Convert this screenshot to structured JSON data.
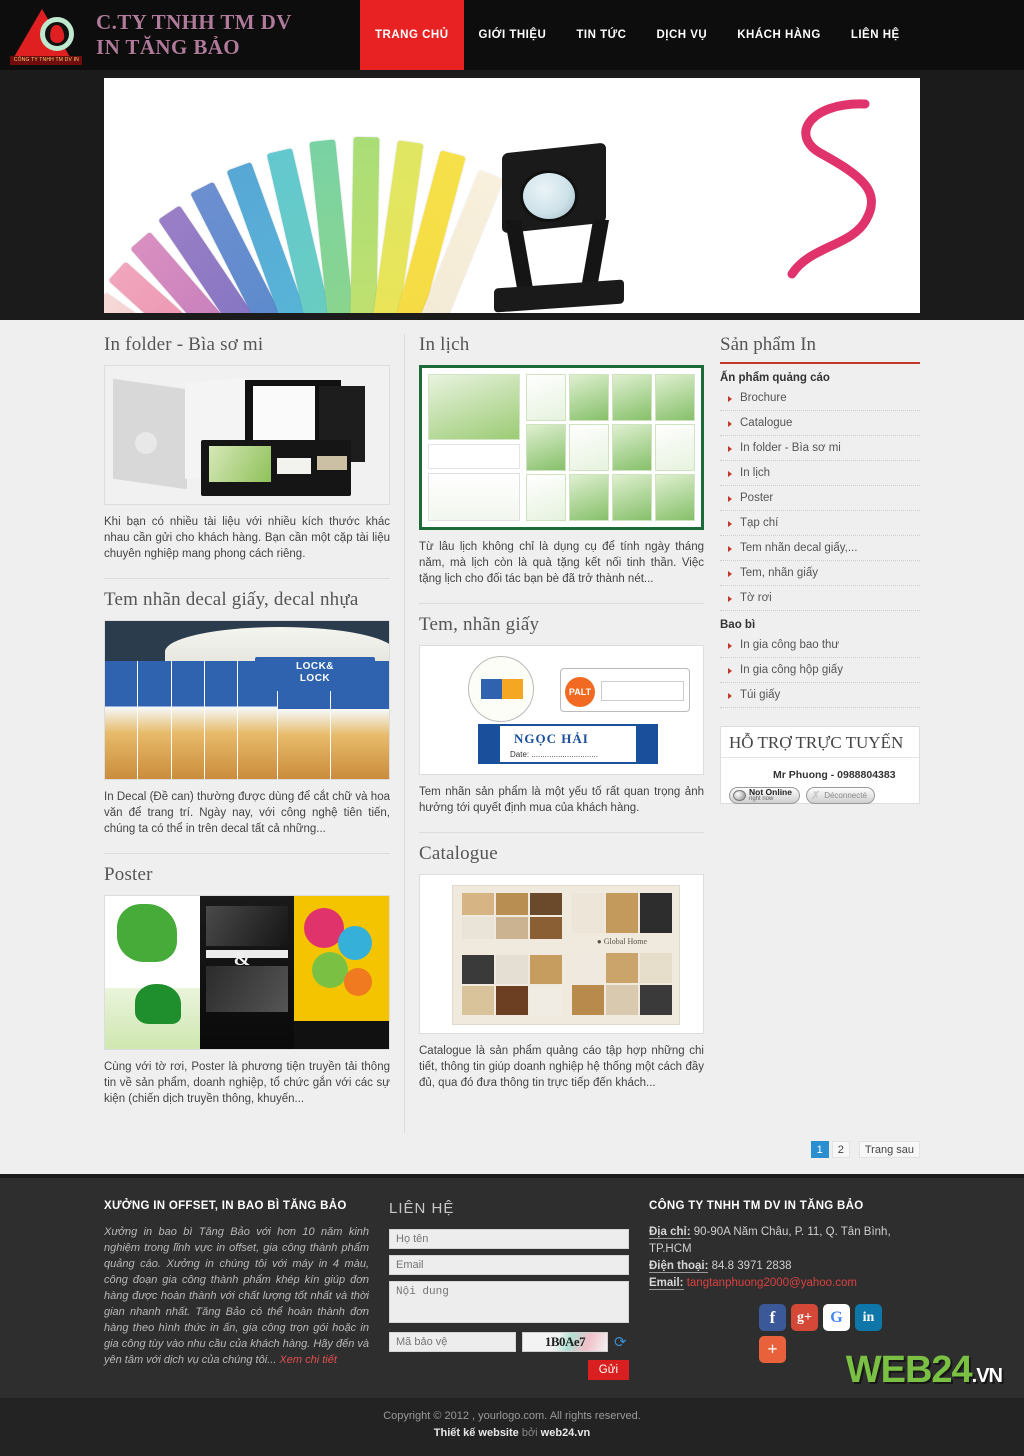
{
  "header": {
    "brand_line1": "C.TY TNHH TM DV",
    "brand_line2": "IN TĂNG BẢO",
    "logo_ribbon": "CÔNG TY TNHH TM DV IN TĂNG BẢO",
    "nav": [
      {
        "label": "TRANG CHỦ",
        "active": true
      },
      {
        "label": "GIỚI THIỆU",
        "active": false
      },
      {
        "label": "TIN TỨC",
        "active": false
      },
      {
        "label": "DỊCH VỤ",
        "active": false
      },
      {
        "label": "KHÁCH HÀNG",
        "active": false
      },
      {
        "label": "LIÊN HỆ",
        "active": false
      }
    ]
  },
  "articles": {
    "col1": [
      {
        "title": "In folder - Bìa sơ mi",
        "excerpt": "Khi bạn có nhiều tài liệu với nhiều kích thước khác nhau cần gửi cho khách hàng. Bạn cần một cặp tài liệu chuyên nghiệp mang phong cách riêng."
      },
      {
        "title": "Tem nhãn decal giấy, decal nhựa",
        "excerpt": "In Decal (Đề can) thường được dùng để cắt chữ và hoa văn để trang trí. Ngày nay, với công nghệ tiên tiến, chúng ta có thể in trên decal tất cả những..."
      },
      {
        "title": "Poster",
        "excerpt": "Cùng với tờ rơi, Poster là phương tiện truyền tải thông tin về sản phẩm, doanh nghiệp, tổ chức gắn với các sự kiện (chiến dịch truyền thông, khuyến..."
      }
    ],
    "col2": [
      {
        "title": "In lịch",
        "excerpt": "Từ lâu lịch không chỉ là dụng cụ để tính ngày tháng năm, mà lịch còn là quà tặng kết nối tinh thần. Việc tặng lịch cho đối tác bạn bè đã trở thành nét..."
      },
      {
        "title": "Tem, nhãn giấy",
        "excerpt": "Tem nhãn sản phẩm là một yếu tố rất quan trọng ảnh hưởng tới quyết định mua của khách hàng."
      },
      {
        "title": "Catalogue",
        "excerpt": "Catalogue là sản phẩm quảng cáo tập hợp những chi tiết, thông tin giúp doanh nghiệp hệ thống một cách đầy đủ, qua đó đưa thông tin trực tiếp đến khách..."
      }
    ]
  },
  "sidebar": {
    "title": "Sản phẩm In",
    "group1_label": "Ấn phẩm quảng cáo",
    "group1_items": [
      "Brochure",
      "Catalogue",
      "In folder - Bìa sơ mi",
      "In lịch",
      "Poster",
      "Tạp chí",
      "Tem nhãn decal giấy,...",
      "Tem, nhãn giấy",
      "Tờ rơi"
    ],
    "group2_label": "Bao bì",
    "group2_items": [
      "In gia công bao thư",
      "In gia công hộp giấy",
      "Túi giấy"
    ],
    "support": {
      "title": "HỖ TRỢ TRỰC TUYẾN",
      "operator": "Mr Phuong - 0988804383",
      "status_main": "Not Online",
      "status_sub": "right now",
      "status_secondary": "Déconnecté"
    }
  },
  "pagination": {
    "pages": [
      "1",
      "2"
    ],
    "current": "1",
    "next_label": "Trang sau"
  },
  "footer": {
    "about": {
      "heading": "XƯỞNG IN OFFSET, IN BAO BÌ TĂNG BẢO",
      "text": "Xưởng in bao bì Tăng Bảo với hơn 10 năm kinh nghiệm trong lĩnh vực in offset, gia công thành phẩm quảng cáo. Xưởng in chúng tôi với máy in 4 màu, công đoạn gia công thành phẩm khép kín giúp đơn hàng được hoàn thành với chất lượng tốt nhất và thời gian nhanh nhất. Tăng Bảo có thể hoàn thành đơn hàng theo hình thức in ấn, gia công trọn gói hoặc in gia công tùy vào nhu cầu của khách hàng. Hãy đến và yên tâm với dịch vụ của chúng tôi...",
      "more_link": "Xem chi tiết"
    },
    "contact_form": {
      "heading": "LIÊN HỆ",
      "name_placeholder": "Họ tên",
      "email_placeholder": "Email",
      "message_placeholder": "Nội dung",
      "captcha_placeholder": "Mã bảo vệ",
      "captcha_value": "1B0Ae7",
      "refresh_icon": "refresh-icon",
      "submit_label": "Gửi"
    },
    "company": {
      "heading": "CÔNG TY TNHH TM DV IN TĂNG BẢO",
      "address_label": "Địa chỉ:",
      "address_value": " 90-90A Năm Châu, P. 11, Q. Tân Bình, TP.HCM",
      "phone_label": "Điện thoại:",
      "phone_value": " 84.8 3971 2838",
      "email_label": "Email:",
      "email_value": " tangtanphuong2000@yahoo.com",
      "socials": [
        "facebook-icon",
        "google-plus-icon",
        "google-icon",
        "linkedin-icon",
        "share-icon"
      ]
    },
    "brandmark": {
      "name": "WEB24",
      "tld": ".VN"
    },
    "copyright_line1": "Copyright © 2012 , yourlogo.com. All rights reserved.",
    "copyright_prefix": "Thiết kế website ",
    "copyright_by": "bởi ",
    "copyright_vendor": "web24.vn"
  }
}
